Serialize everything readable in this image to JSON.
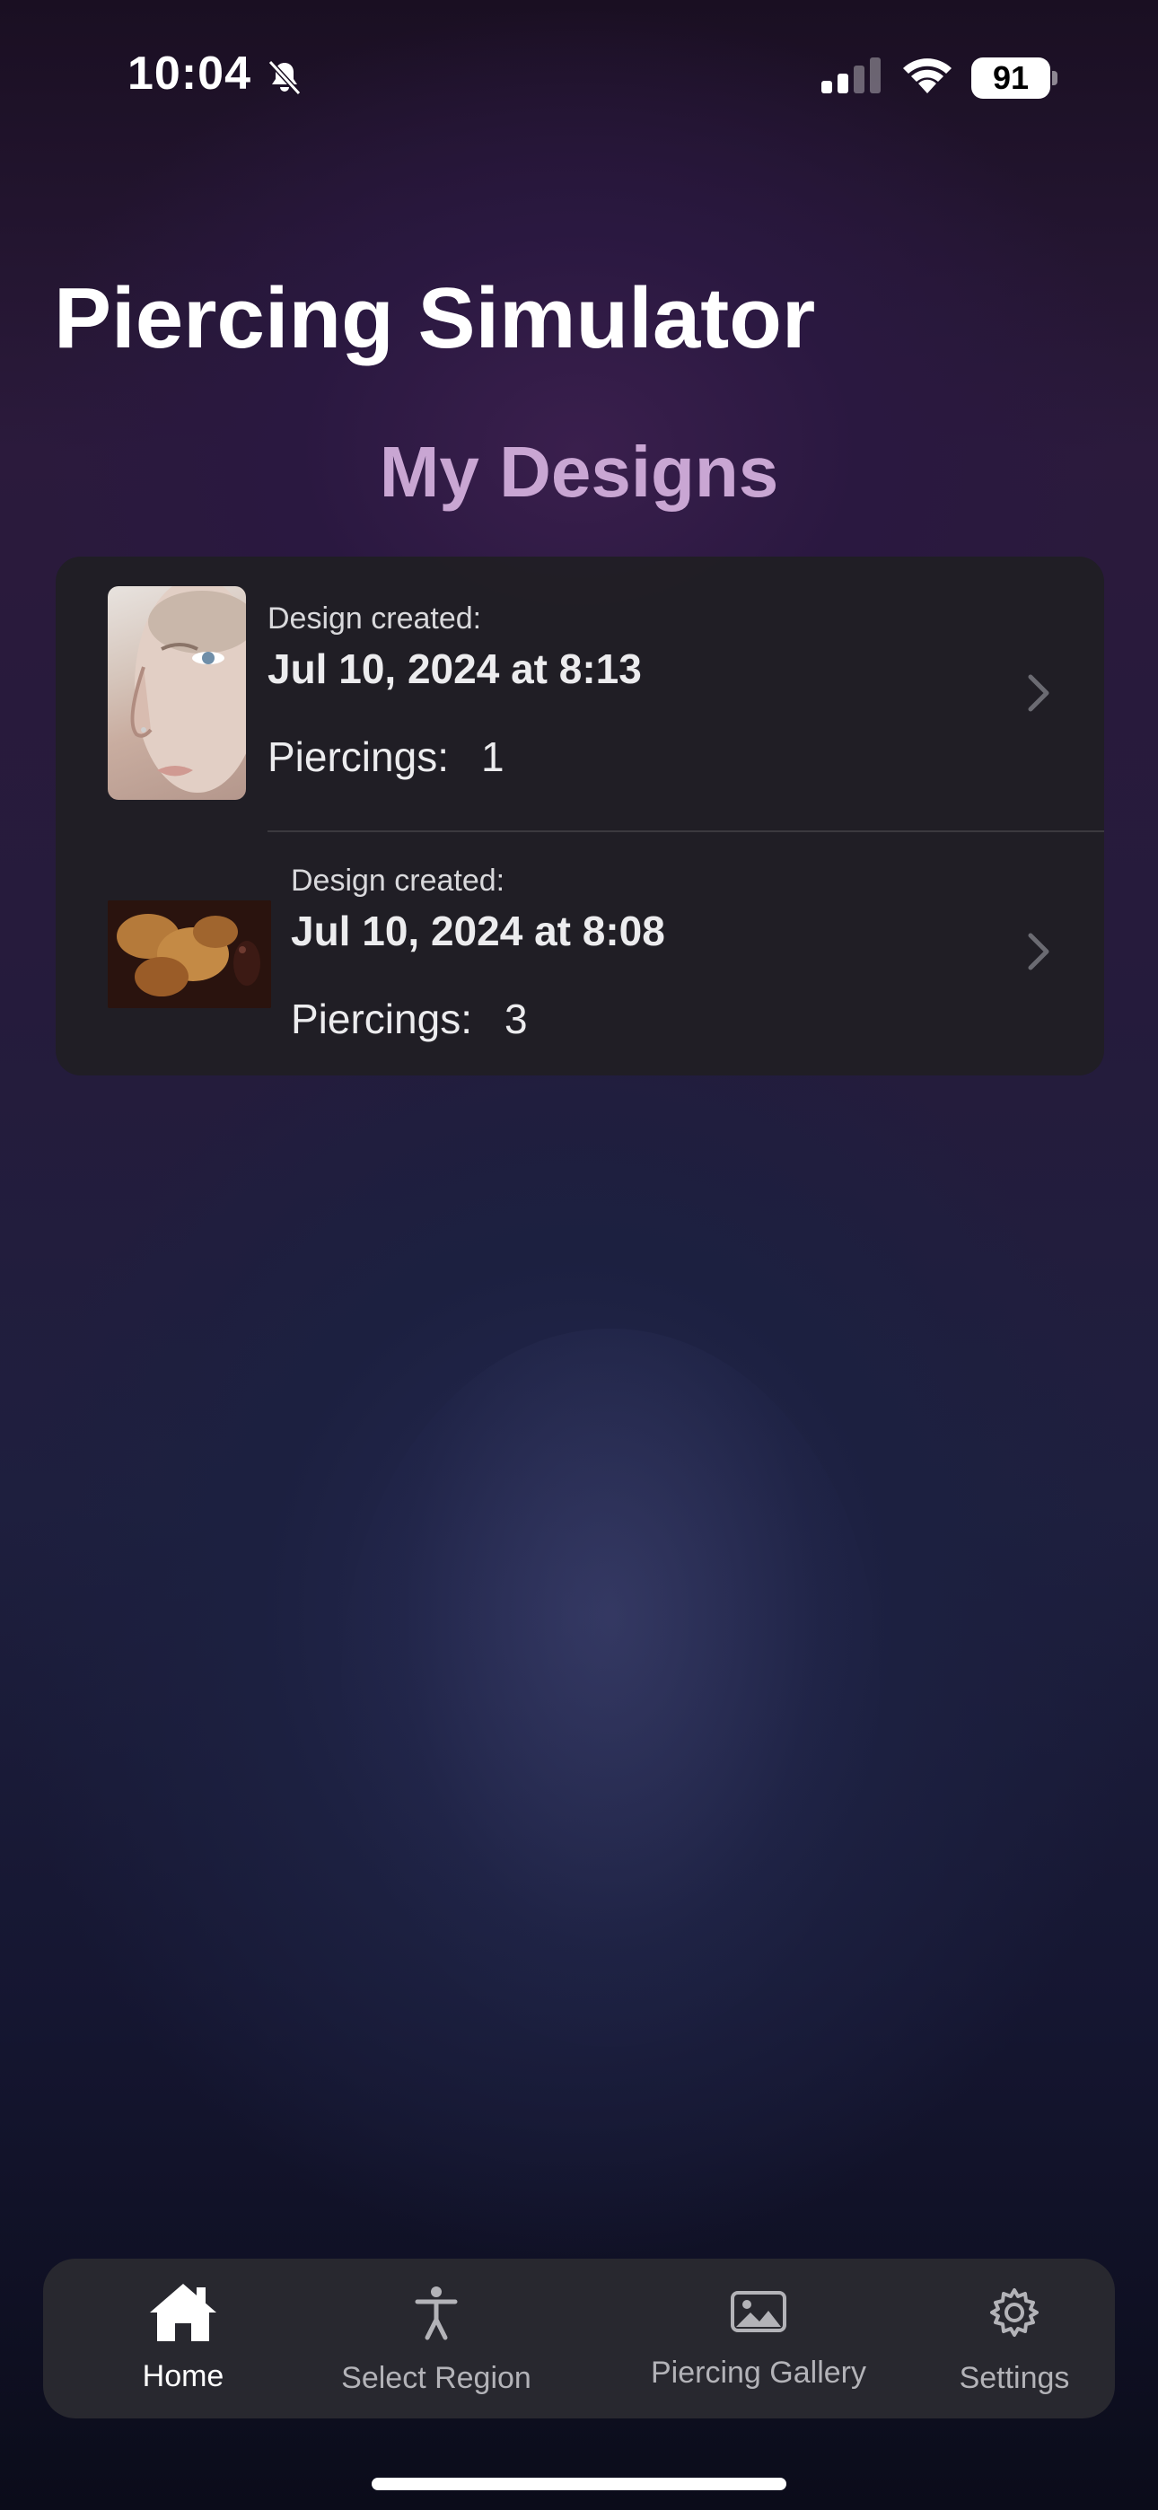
{
  "status_bar": {
    "time": "10:04",
    "battery": "91"
  },
  "app": {
    "title": "Piercing Simulator"
  },
  "section": {
    "title": "My Designs"
  },
  "designs": [
    {
      "created_label": "Design created:",
      "date": "Jul 10, 2024 at 8:13",
      "piercings_label": "Piercings:",
      "piercings_count": "1"
    },
    {
      "created_label": "Design created:",
      "date": "Jul 10, 2024 at 8:08",
      "piercings_label": "Piercings:",
      "piercings_count": "3"
    }
  ],
  "tab_bar": {
    "items": [
      {
        "label": "Home",
        "icon": "house-icon",
        "selected": true
      },
      {
        "label": "Select Region",
        "icon": "person-icon",
        "selected": false
      },
      {
        "label": "Piercing Gallery",
        "icon": "photo-icon",
        "selected": false
      },
      {
        "label": "Settings",
        "icon": "gear-icon",
        "selected": false
      }
    ]
  },
  "colors": {
    "accent_title": "#c9a6d3",
    "card_bg": "#201e24",
    "tab_bar_bg": "#2a2a30"
  }
}
